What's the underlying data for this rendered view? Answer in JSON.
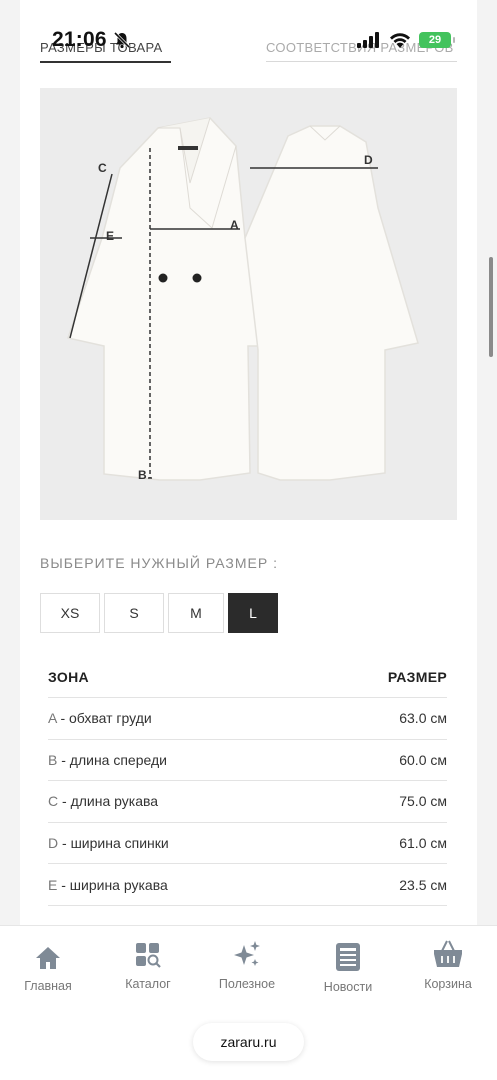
{
  "status": {
    "time": "21:06",
    "battery": "29"
  },
  "tabs": {
    "active": "РАЗМЕРЫ ТОВАРА",
    "inactive": "СООТВЕТСТВИЯ РАЗМЕРОВ"
  },
  "diagram": {
    "labels": [
      "A",
      "B",
      "C",
      "D",
      "E"
    ]
  },
  "select_title": "ВЫБЕРИТЕ НУЖНЫЙ РАЗМЕР :",
  "sizes": {
    "xs": "XS",
    "s": "S",
    "m": "M",
    "l": "L",
    "selected": "L"
  },
  "table": {
    "header_zone": "ЗОНА",
    "header_size": "РАЗМЕР",
    "rows": [
      {
        "letter": "A",
        "label": " - обхват груди",
        "value": "63.0 см"
      },
      {
        "letter": "B",
        "label": " - длина спереди",
        "value": "60.0 см"
      },
      {
        "letter": "C",
        "label": " - длина рукава",
        "value": "75.0 см"
      },
      {
        "letter": "D",
        "label": " - ширина спинки",
        "value": "61.0 см"
      },
      {
        "letter": "E",
        "label": " - ширина рукава",
        "value": "23.5 см"
      }
    ]
  },
  "nav": {
    "home": "Главная",
    "catalog": "Каталог",
    "useful": "Полезное",
    "news": "Новости",
    "cart": "Корзина"
  },
  "url": "zararu.ru",
  "colors": {
    "nav_icon": "#7f8a96",
    "selected_size": "#2b2b2b",
    "battery": "#43c35d"
  }
}
